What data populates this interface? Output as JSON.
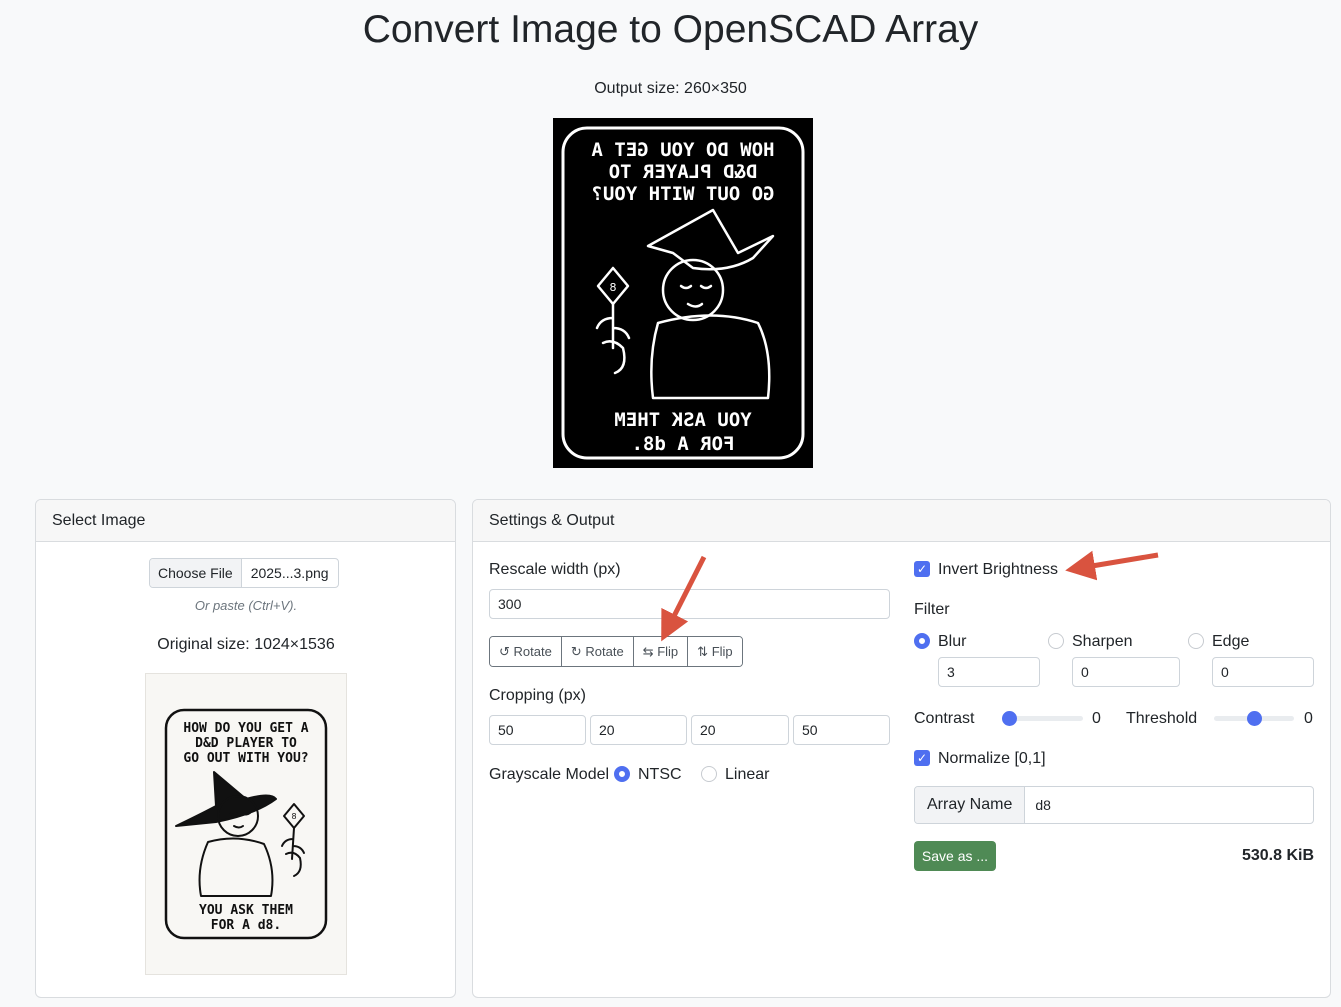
{
  "page": {
    "title": "Convert Image to OpenSCAD Array",
    "output_size": "Output size: 260×350"
  },
  "preview_image": {
    "line1": "HOW DO YOU GET A",
    "line2": "D&D PLAYER TO",
    "line3": "GO OUT WITH YOU?",
    "line4": "YOU ASK THEM",
    "line5": "FOR A d8.",
    "die_label": "8"
  },
  "select_image": {
    "header": "Select Image",
    "choose_file_label": "Choose File",
    "file_name": "2025...3.png",
    "paste_hint": "Or paste (Ctrl+V).",
    "original_size": "Original size: 1024×1536"
  },
  "settings": {
    "header": "Settings & Output",
    "rescale_label": "Rescale width (px)",
    "rescale_value": "300",
    "transform_buttons": [
      {
        "icon": "↺",
        "label": "Rotate"
      },
      {
        "icon": "↻",
        "label": "Rotate"
      },
      {
        "icon": "⇆",
        "label": "Flip"
      },
      {
        "icon": "⇅",
        "label": "Flip"
      }
    ],
    "cropping_label": "Cropping (px)",
    "crop_values": [
      "50",
      "20",
      "20",
      "50"
    ],
    "grayscale_label": "Grayscale Model",
    "grayscale_options": [
      "NTSC",
      "Linear"
    ],
    "grayscale_selected": "NTSC",
    "invert_label": "Invert Brightness",
    "invert_checked": true,
    "filter_label": "Filter",
    "filters": [
      {
        "label": "Blur",
        "value": "3"
      },
      {
        "label": "Sharpen",
        "value": "0"
      },
      {
        "label": "Edge",
        "value": "0"
      }
    ],
    "filter_selected": "Blur",
    "contrast_label": "Contrast",
    "contrast_value": "0",
    "threshold_label": "Threshold",
    "threshold_value": "0",
    "normalize_label": "Normalize [0,1]",
    "normalize_checked": true,
    "array_name_label": "Array Name",
    "array_name_value": "d8",
    "save_label": "Save as ...",
    "file_size": "530.8 KiB"
  },
  "colors": {
    "accent": "#4f6ff0",
    "save_button": "#4f8a55",
    "annotation_arrow": "#d9533f"
  }
}
